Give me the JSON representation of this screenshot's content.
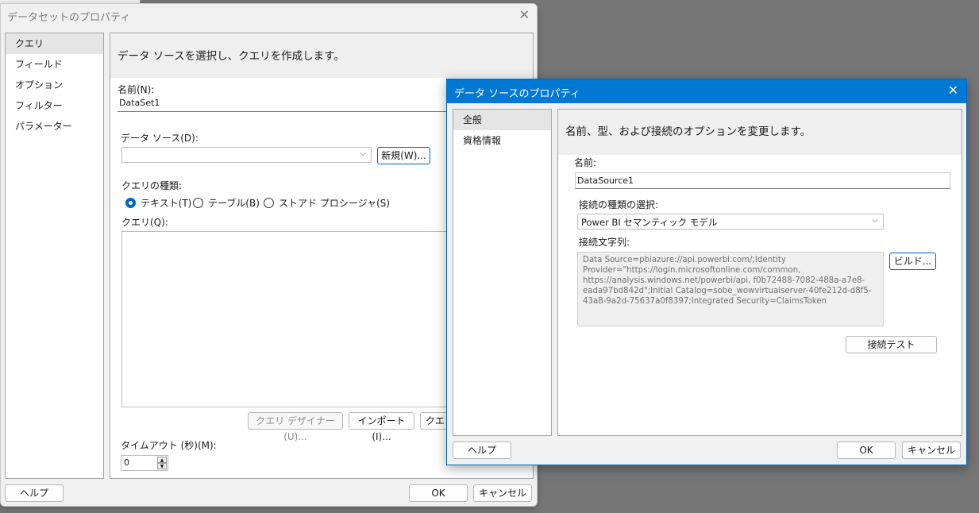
{
  "dataset_window": {
    "title": "データセットのプロパティ",
    "nav_items": [
      "クエリ",
      "フィールド",
      "オプション",
      "フィルター",
      "パラメーター"
    ],
    "header_text": "データ ソースを選択し、クエリを作成します。",
    "name_label": "名前(N):",
    "name_value": "DataSet1",
    "datasource_label": "データ ソース(D):",
    "datasource_value": "",
    "new_button": "新規(W)...",
    "query_type_label": "クエリの種類:",
    "query_types": [
      "テキスト(T)",
      "テーブル(B)",
      "ストアド プロシージャ(S)"
    ],
    "query_label": "クエリ(Q):",
    "query_designer_button": "クエリ デザイナー(U)...",
    "import_button": "インポート(I)...",
    "query_partial_button": "クエリ",
    "timeout_label": "タイムアウト (秒)(M):",
    "timeout_value": "0",
    "help_button": "ヘルプ",
    "ok_button": "OK",
    "cancel_button": "キャンセル"
  },
  "datasource_window": {
    "title": "データ ソースのプロパティ",
    "nav_items": [
      "全般",
      "資格情報"
    ],
    "header_text": "名前、型、および接続のオプションを変更します。",
    "name_label": "名前:",
    "name_value": "DataSource1",
    "conn_type_label": "接続の種類の選択:",
    "conn_type_value": "Power BI セマンティック モデル",
    "conn_string_label": "接続文字列:",
    "conn_string_lines": [
      "Data Source=pbiazure://api.powerbi.com/;Identity",
      "Provider=\"https://login.microsoftonline.com/common,",
      "https://analysis.windows.net/powerbi/api, f0b72488-7082-488a-a7e8-",
      "eada97bd842d\";Initial Catalog=sobe_wowvirtualserver-40fe212d-d8f5-",
      "43a8-9a2d-75637a0f8397;Integrated Security=ClaimsToken"
    ],
    "build_button": "ビルド...",
    "test_button": "接続テスト",
    "help_button": "ヘルプ",
    "ok_button": "OK",
    "cancel_button": "キャンセル"
  },
  "icons": {
    "close": "close-icon",
    "dropdown": "chevron-down-icon"
  }
}
